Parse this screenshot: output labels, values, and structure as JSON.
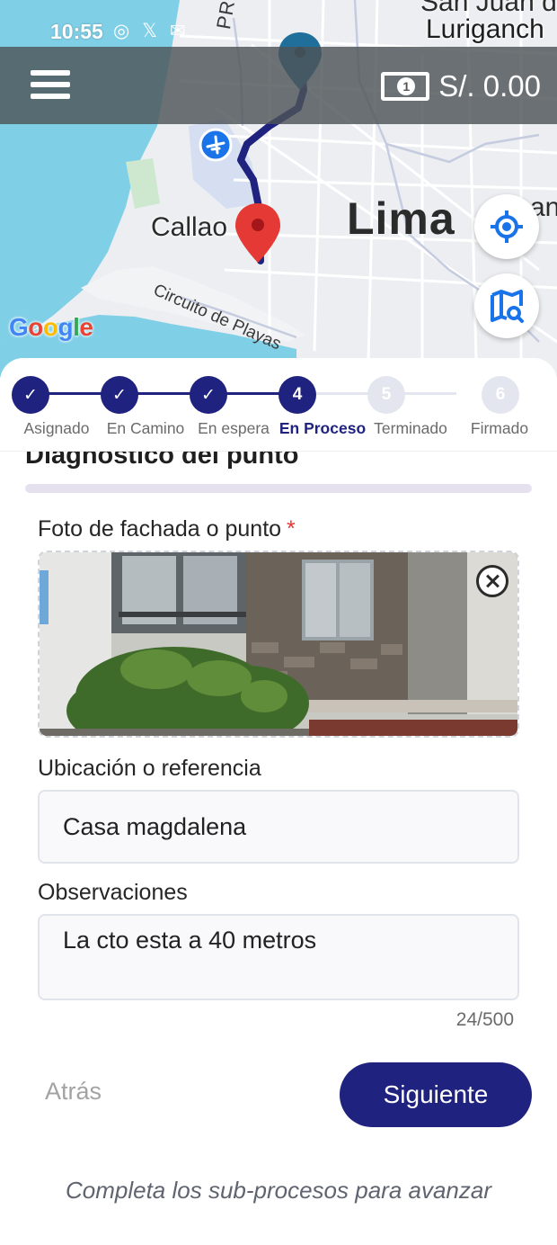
{
  "status_bar": {
    "time": "10:55",
    "icons": "◎ 𝕏 ✉"
  },
  "map": {
    "labels": {
      "lima": "Lima",
      "callao": "Callao",
      "san_juan": "San Juan d",
      "lurigancho": "Luriganch",
      "an": "an",
      "provi": "PROVI",
      "circuito": "Circuito de Playas"
    },
    "google": {
      "g1": "G",
      "o1": "o",
      "o2": "o",
      "g2": "g",
      "l": "l",
      "e": "e"
    },
    "route_color": "#1f237f",
    "origin_pin_color": "#1f6f9a",
    "destination_pin_color": "#e53935"
  },
  "top_bar": {
    "balance": "S/. 0.00",
    "money_icon_symbol": "1"
  },
  "stepper": {
    "current_step": 4,
    "steps": [
      {
        "number": "1",
        "label": "Asignado",
        "state": "done"
      },
      {
        "number": "2",
        "label": "En Camino",
        "state": "done"
      },
      {
        "number": "3",
        "label": "En espera",
        "state": "done"
      },
      {
        "number": "4",
        "label": "En Proceso",
        "state": "active"
      },
      {
        "number": "5",
        "label": "Terminado",
        "state": "pending"
      },
      {
        "number": "6",
        "label": "Firmado",
        "state": "pending"
      }
    ]
  },
  "form": {
    "section_title": "Diagnostico del punto",
    "photo_label": "Foto de fachada o punto",
    "required_mark": "*",
    "location_label": "Ubicación o referencia",
    "location_value": "Casa magdalena",
    "observations_label": "Observaciones",
    "observations_value": "La cto esta a 40 metros",
    "char_count": "24/500"
  },
  "actions": {
    "back_label": "Atrás",
    "next_label": "Siguiente"
  },
  "hint": "Completa los sub-procesos para avanzar",
  "colors": {
    "primary": "#1f237f",
    "required": "#e53935",
    "pending_step": "#e3e6ee"
  }
}
